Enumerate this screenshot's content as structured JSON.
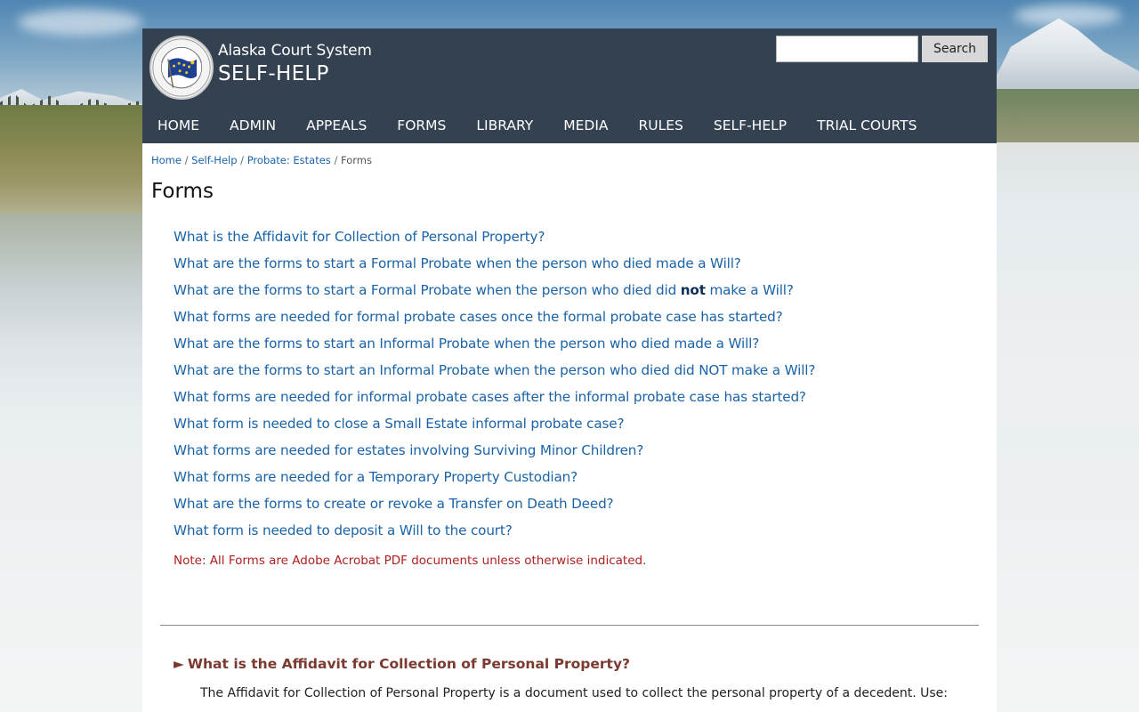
{
  "header": {
    "site_name": "Alaska Court System",
    "section_name": "SELF-HELP",
    "search_placeholder": "",
    "search_button_label": "Search"
  },
  "nav": {
    "items": [
      {
        "label": "HOME"
      },
      {
        "label": "ADMIN"
      },
      {
        "label": "APPEALS"
      },
      {
        "label": "FORMS"
      },
      {
        "label": "LIBRARY"
      },
      {
        "label": "MEDIA"
      },
      {
        "label": "RULES"
      },
      {
        "label": "SELF-HELP"
      },
      {
        "label": "TRIAL COURTS"
      }
    ]
  },
  "breadcrumb": {
    "items": [
      "Home",
      "Self-Help",
      "Probate: Estates"
    ],
    "current": "Forms",
    "separator": "/"
  },
  "page": {
    "title": "Forms",
    "faq_links": [
      {
        "text": "What is the Affidavit for Collection of Personal Property?"
      },
      {
        "text": "What are the forms to start a Formal Probate when the person who died made a Will?"
      },
      {
        "text_before": "What are the forms to start a Formal Probate when the person who died did ",
        "text_bold": "not",
        "text_after": " make a Will?"
      },
      {
        "text": "What forms are needed for formal probate cases once the formal probate case has started?"
      },
      {
        "text": "What are the forms to start an Informal Probate when the person who died made a Will?"
      },
      {
        "text": "What are the forms to start an Informal Probate when the person who died did NOT make a Will?"
      },
      {
        "text": "What forms are needed for informal probate cases after the informal probate case has started?"
      },
      {
        "text": "What form is needed to close a Small Estate informal probate case?"
      },
      {
        "text": "What forms are needed for estates involving Surviving Minor Children?"
      },
      {
        "text": "What forms are needed for a Temporary Property Custodian?"
      },
      {
        "text": "What are the forms to create or revoke a Transfer on Death Deed?"
      },
      {
        "text": "What form is needed to deposit a Will to the court?"
      }
    ],
    "note": "Note: All Forms are Adobe Acrobat PDF documents unless otherwise indicated.",
    "section": {
      "arrow": "►",
      "heading": "What is the Affidavit for Collection of Personal Property?",
      "body": "The Affidavit for Collection of Personal Property is a document used to collect the personal property of a decedent. Use:"
    }
  },
  "colors": {
    "header_bg": "#344150",
    "link": "#1a63a8",
    "note": "#b02020",
    "section_heading": "#7a3a30"
  },
  "icons": {
    "seal": "alaska-court-seal-icon"
  }
}
